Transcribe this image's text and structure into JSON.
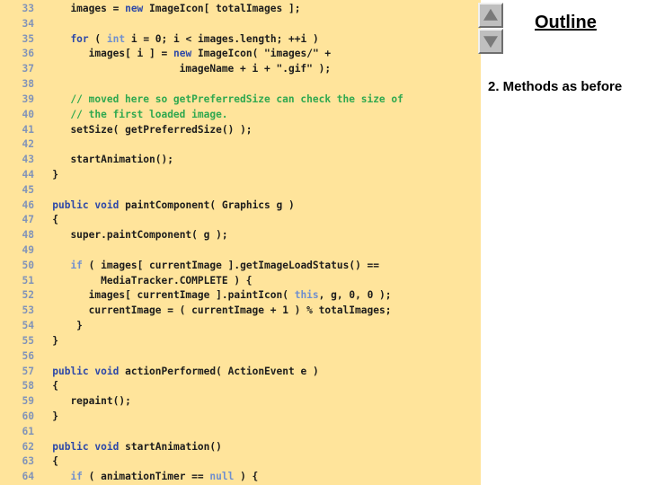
{
  "code_panel": {
    "background_color": "#ffe49b",
    "lineno_color": "#8193b8",
    "comment_color": "#2fa84f",
    "keyword_dark_color": "#2d48a8",
    "keyword_light_color": "#6f8fcf",
    "first_line_number": 33,
    "last_line_number": 64,
    "lines": [
      {
        "no": "33",
        "text": "    images = new ImageIcon[ totalImages ];"
      },
      {
        "no": "34",
        "text": ""
      },
      {
        "no": "35",
        "text": "    for ( int i = 0; i < images.length; ++i )"
      },
      {
        "no": "36",
        "text": "       images[ i ] = new ImageIcon( \"images/\" +"
      },
      {
        "no": "37",
        "text": "                      imageName + i + \".gif\" );"
      },
      {
        "no": "38",
        "text": ""
      },
      {
        "no": "39",
        "text": "    // moved here so getPreferredSize can check the size of"
      },
      {
        "no": "40",
        "text": "    // the first loaded image."
      },
      {
        "no": "41",
        "text": "    setSize( getPreferredSize() );"
      },
      {
        "no": "42",
        "text": ""
      },
      {
        "no": "43",
        "text": "    startAnimation();"
      },
      {
        "no": "44",
        "text": " }"
      },
      {
        "no": "45",
        "text": ""
      },
      {
        "no": "46",
        "text": " public void paintComponent( Graphics g )"
      },
      {
        "no": "47",
        "text": " {"
      },
      {
        "no": "48",
        "text": "    super.paintComponent( g );"
      },
      {
        "no": "49",
        "text": ""
      },
      {
        "no": "50",
        "text": "    if ( images[ currentImage ].getImageLoadStatus() =="
      },
      {
        "no": "51",
        "text": "         MediaTracker.COMPLETE ) {"
      },
      {
        "no": "52",
        "text": "       images[ currentImage ].paintIcon( this, g, 0, 0 );"
      },
      {
        "no": "53",
        "text": "       currentImage = ( currentImage + 1 ) % totalImages;"
      },
      {
        "no": "54",
        "text": "     }"
      },
      {
        "no": "55",
        "text": " }"
      },
      {
        "no": "56",
        "text": ""
      },
      {
        "no": "57",
        "text": " public void actionPerformed( ActionEvent e )"
      },
      {
        "no": "58",
        "text": " {"
      },
      {
        "no": "59",
        "text": "    repaint();"
      },
      {
        "no": "60",
        "text": " }"
      },
      {
        "no": "61",
        "text": ""
      },
      {
        "no": "62",
        "text": " public void startAnimation()"
      },
      {
        "no": "63",
        "text": " {"
      },
      {
        "no": "64",
        "text": "    if ( animationTimer == null ) {"
      }
    ]
  },
  "outline": {
    "title": "Outline",
    "items": [
      {
        "label": "2. Methods as before"
      }
    ],
    "scroll_up_icon": "triangle-up-icon",
    "scroll_down_icon": "triangle-down-icon"
  }
}
